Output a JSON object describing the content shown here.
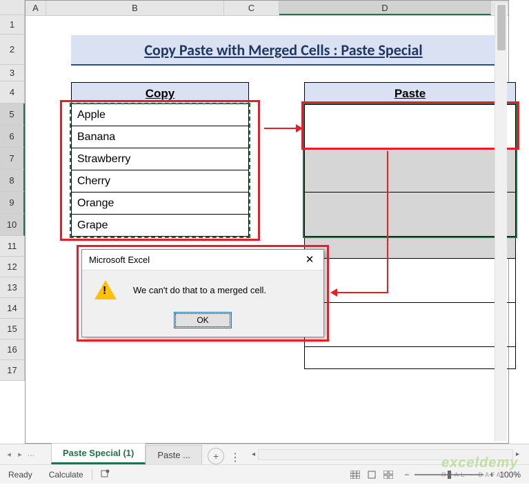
{
  "columns": {
    "a": "A",
    "b": "B",
    "c": "C",
    "d": "D"
  },
  "rows": [
    "1",
    "2",
    "3",
    "4",
    "5",
    "6",
    "7",
    "8",
    "9",
    "10",
    "11",
    "12",
    "13",
    "14",
    "15",
    "16",
    "17"
  ],
  "title": "Copy Paste with Merged Cells : Paste Special",
  "copyHeader": "Copy",
  "pasteHeader": "Paste",
  "copyData": [
    "Apple",
    "Banana",
    "Strawberry",
    "Cherry",
    "Orange",
    "Grape"
  ],
  "dialog": {
    "title": "Microsoft Excel",
    "close": "✕",
    "message": "We can't do that to a merged cell.",
    "ok": "OK"
  },
  "tabs": {
    "active": "Paste Special (1)",
    "other": "Paste ...",
    "nav": {
      "first": "◂",
      "last": "▸",
      "dots": "…"
    }
  },
  "status": {
    "ready": "Ready",
    "calc": "Calculate",
    "zoom": "100%",
    "minus": "−",
    "plus": "+"
  },
  "watermark": {
    "main": "exceldemy",
    "sub": "REAL - DATA!!!!"
  }
}
